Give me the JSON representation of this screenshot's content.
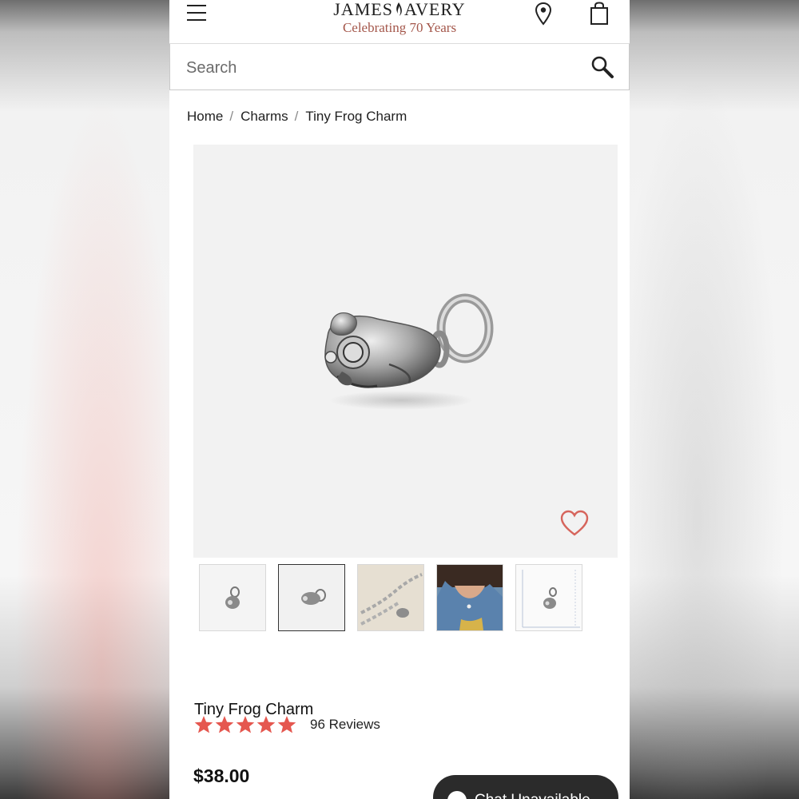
{
  "header": {
    "brand_name_left": "JAMES",
    "brand_name_right": "AVERY",
    "brand_tagline": "Celebrating 70 Years",
    "icons": [
      "menu-icon",
      "location-pin-icon",
      "shopping-bag-icon"
    ]
  },
  "search": {
    "placeholder": "Search",
    "icon": "search-icon"
  },
  "breadcrumb": {
    "items": [
      "Home",
      "Charms",
      "Tiny Frog Charm"
    ],
    "separator": "/"
  },
  "gallery": {
    "wishlist_icon": "heart-icon",
    "selected_thumbnail": 2,
    "thumbnail_count": 5
  },
  "product": {
    "title": "Tiny Frog Charm",
    "rating": 5,
    "rating_max": 5,
    "reviews_label": "96 Reviews",
    "price": "$38.00"
  },
  "chat": {
    "label": "Chat Unavailable"
  },
  "colors": {
    "accent_brand": "#a4574b",
    "star": "#e5574f",
    "heart": "#d6655c",
    "chat_bg": "#2b2b2b"
  }
}
